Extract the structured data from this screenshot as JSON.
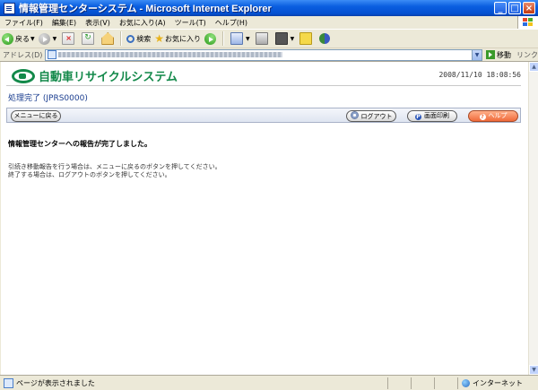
{
  "window": {
    "title": "情報管理センターシステム - Microsoft Internet Explorer",
    "controls": {
      "minimize": "_",
      "maximize": "□",
      "close": "×"
    }
  },
  "menu": [
    "ファイル(F)",
    "編集(E)",
    "表示(V)",
    "お気に入り(A)",
    "ツール(T)",
    "ヘルプ(H)"
  ],
  "toolbar": {
    "back": "戻る",
    "search": "検索",
    "favorites": "お気に入り"
  },
  "address": {
    "label": "アドレス(D)",
    "go": "移動",
    "links": "リンク"
  },
  "page": {
    "logo_text": "自動車リサイクルシステム",
    "datetime": "2008/11/10 18:08:56",
    "title": "処理完了 (JPRS0000)",
    "buttons": {
      "menu_back": "メニューに戻る",
      "logout": "ログアウト",
      "print": "画面印刷",
      "help": "ヘルプ"
    },
    "message": "情報管理センターへの報告が完了しました。",
    "instructions": [
      "引続き移動報告を行う場合は、メニューに戻るのボタンを押してください。",
      "終了する場合は、ログアウトのボタンを押してください。"
    ]
  },
  "status": {
    "text": "ページが表示されました",
    "zone": "インターネット"
  },
  "colors": {
    "brand_green": "#13894a",
    "title_blue": "#1a3d8f",
    "help_orange": "#f06a3a"
  }
}
